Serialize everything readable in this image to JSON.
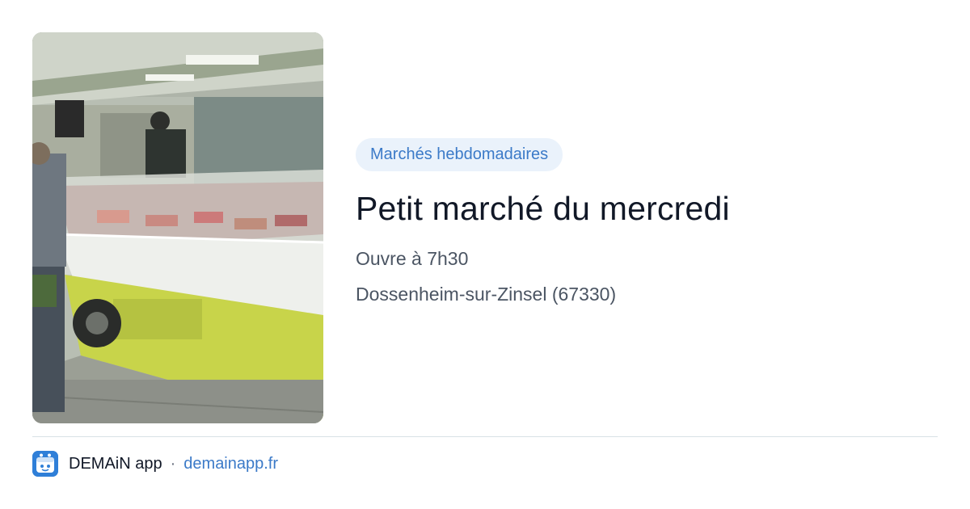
{
  "card": {
    "category": "Marchés hebdomadaires",
    "title": "Petit marché du mercredi",
    "opening": "Ouvre à 7h30",
    "location": "Dossenheim-sur-Zinsel (67330)"
  },
  "footer": {
    "app_name": "DEMAiN app",
    "separator": "·",
    "url": "demainapp.fr"
  },
  "colors": {
    "accent": "#3b7ac8",
    "badge_bg": "#eaf2fb",
    "title": "#111827",
    "meta": "#4b5563"
  },
  "icons": {
    "app_logo": "demain-logo-icon"
  }
}
